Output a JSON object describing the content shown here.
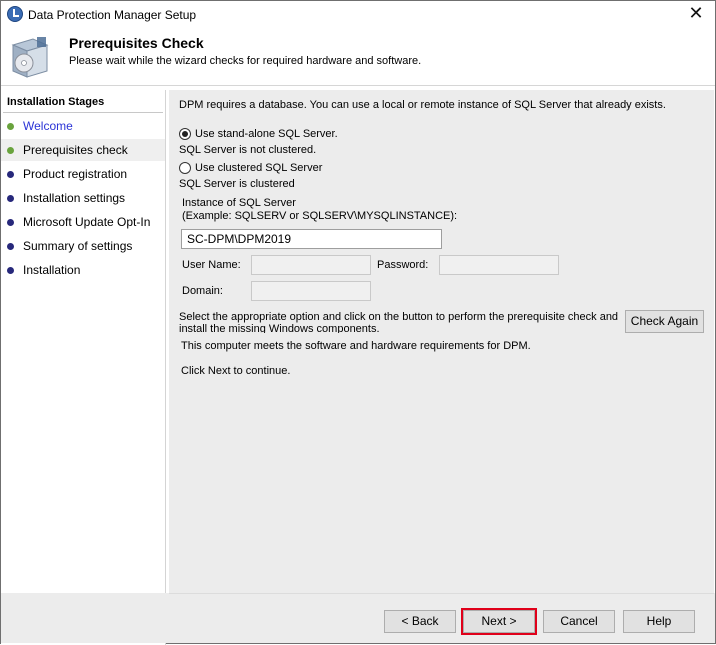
{
  "window": {
    "title": "Data Protection Manager Setup",
    "close_glyph": "✕"
  },
  "header": {
    "title": "Prerequisites Check",
    "subtitle": "Please wait while the wizard checks for required hardware and software."
  },
  "stages": {
    "title": "Installation Stages",
    "items": [
      {
        "label": "Welcome",
        "state": "done"
      },
      {
        "label": "Prerequisites check",
        "state": "active"
      },
      {
        "label": "Product registration",
        "state": "pending"
      },
      {
        "label": "Installation settings",
        "state": "pending"
      },
      {
        "label": "Microsoft Update Opt-In",
        "state": "pending"
      },
      {
        "label": "Summary of settings",
        "state": "pending"
      },
      {
        "label": "Installation",
        "state": "pending"
      }
    ]
  },
  "main": {
    "intro": "DPM requires a database. You can use a local or remote instance of SQL Server that already exists.",
    "standalone_label": "Use stand-alone SQL Server.",
    "standalone_note": "SQL Server is not clustered.",
    "clustered_label": "Use clustered SQL Server",
    "clustered_note": "SQL Server is clustered",
    "instance_label": "Instance of SQL Server",
    "instance_example": "(Example: SQLSERV or SQLSERV\\MYSQLINSTANCE):",
    "instance_value": "SC-DPM\\DPM2019",
    "username_label": "User Name:",
    "username_value": "",
    "password_label": "Password:",
    "password_value": "",
    "domain_label": "Domain:",
    "domain_value": "",
    "check_instructions_1": "Select the appropriate option and click on the button  to perform the prerequisite check and",
    "check_instructions_2": "install the missing Windows components.",
    "check_again_label": "Check Again",
    "result_message": "This computer meets the software and hardware requirements for DPM.",
    "next_instruction": "Click Next to continue."
  },
  "buttons": {
    "back": "< Back",
    "next": "Next >",
    "cancel": "Cancel",
    "help": "Help"
  },
  "colors": {
    "highlight": "#e0001a",
    "done_dot": "#69a33d",
    "pending_dot": "#27287b",
    "link_text": "#2b34d6"
  },
  "icons": {
    "app": "dpm-app-icon",
    "header": "setup-box-icon",
    "close": "close-icon"
  }
}
